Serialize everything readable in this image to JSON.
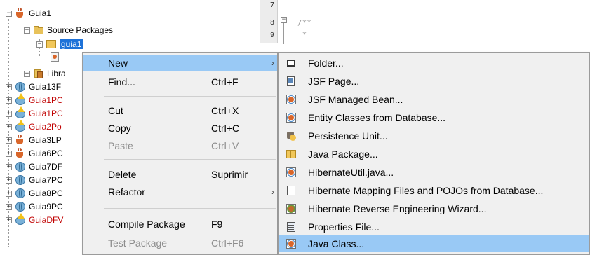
{
  "tree": {
    "root": "Guia1",
    "source_packages": "Source Packages",
    "package": "guia1",
    "libraries": "Libra",
    "projects": [
      {
        "label": "Guia13F",
        "icon": "globe-icon",
        "red": false
      },
      {
        "label": "Guia1PC",
        "icon": "warning-globe-icon",
        "red": true
      },
      {
        "label": "Guia1PC",
        "icon": "warning-globe-icon",
        "red": true
      },
      {
        "label": "Guia2Po",
        "icon": "warning-globe-icon",
        "red": true
      },
      {
        "label": "Guia3LP",
        "icon": "coffee-cup-icon",
        "red": false
      },
      {
        "label": "Guia6PC",
        "icon": "coffee-cup-icon",
        "red": false
      },
      {
        "label": "Guia7DF",
        "icon": "globe-icon",
        "red": false
      },
      {
        "label": "Guia7PC",
        "icon": "globe-icon",
        "red": false
      },
      {
        "label": "Guia8PC",
        "icon": "globe-icon",
        "red": false
      },
      {
        "label": "Guia9PC",
        "icon": "globe-icon",
        "red": false
      },
      {
        "label": "GuiaDFV",
        "icon": "warning-globe-icon",
        "red": true
      }
    ]
  },
  "editor": {
    "line_numbers": [
      "7",
      "8",
      "9"
    ],
    "code_lines": [
      "/**",
      " *"
    ]
  },
  "context_menu": {
    "items": [
      {
        "label": "New",
        "shortcut": "",
        "submenu": true,
        "highlighted": true,
        "disabled": false
      },
      {
        "label": "Find...",
        "shortcut": "Ctrl+F",
        "submenu": false,
        "highlighted": false,
        "disabled": false
      },
      {
        "label": "Cut",
        "shortcut": "Ctrl+X",
        "submenu": false,
        "highlighted": false,
        "disabled": false
      },
      {
        "label": "Copy",
        "shortcut": "Ctrl+C",
        "submenu": false,
        "highlighted": false,
        "disabled": false
      },
      {
        "label": "Paste",
        "shortcut": "Ctrl+V",
        "submenu": false,
        "highlighted": false,
        "disabled": true
      },
      {
        "label": "Delete",
        "shortcut": "Suprimir",
        "submenu": false,
        "highlighted": false,
        "disabled": false
      },
      {
        "label": "Refactor",
        "shortcut": "",
        "submenu": true,
        "highlighted": false,
        "disabled": false
      },
      {
        "label": "Compile Package",
        "shortcut": "F9",
        "submenu": false,
        "highlighted": false,
        "disabled": false
      },
      {
        "label": "Test Package",
        "shortcut": "Ctrl+F6",
        "submenu": false,
        "highlighted": false,
        "disabled": true
      }
    ]
  },
  "new_submenu": {
    "items": [
      {
        "label": "Folder...",
        "icon": "folder-icon"
      },
      {
        "label": "JSF Page...",
        "icon": "jsf-page-icon"
      },
      {
        "label": "JSF Managed Bean...",
        "icon": "managed-bean-icon"
      },
      {
        "label": "Entity Classes from Database...",
        "icon": "entity-class-icon"
      },
      {
        "label": "Persistence Unit...",
        "icon": "persistence-unit-icon"
      },
      {
        "label": "Java Package...",
        "icon": "java-package-icon"
      },
      {
        "label": "HibernateUtil.java...",
        "icon": "hibernate-util-icon"
      },
      {
        "label": "Hibernate Mapping Files and POJOs from Database...",
        "icon": "document-icon"
      },
      {
        "label": "Hibernate Reverse Engineering Wizard...",
        "icon": "wizard-icon"
      },
      {
        "label": "Properties File...",
        "icon": "properties-file-icon"
      },
      {
        "label": "Java Class...",
        "icon": "java-class-icon",
        "highlighted": true
      }
    ]
  },
  "colors": {
    "menu_background": "#f0f0f0",
    "highlight": "#99c9f5",
    "selection": "#1e72d8",
    "error_text": "#c00000"
  }
}
